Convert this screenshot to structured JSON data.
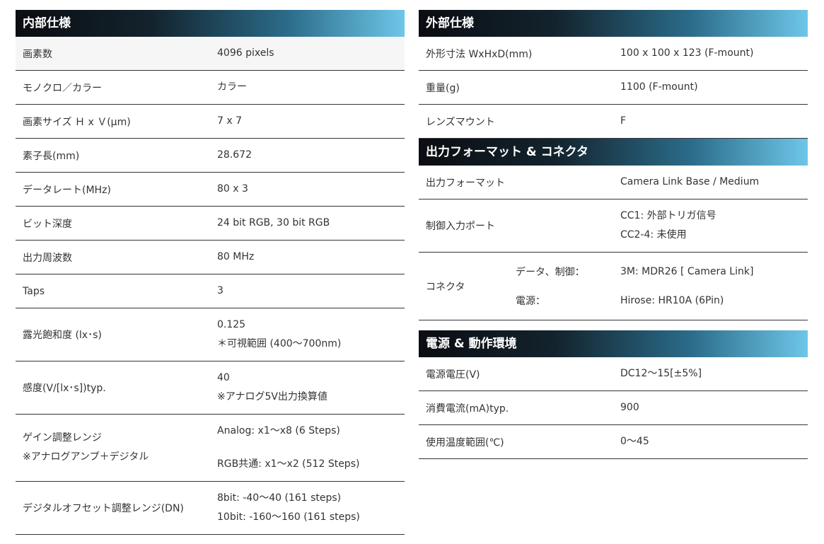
{
  "left": {
    "title": "内部仕様",
    "rows": [
      {
        "label": "画素数",
        "values": [
          "4096 pixels"
        ]
      },
      {
        "label": "モノクロ／カラー",
        "values": [
          "カラー"
        ]
      },
      {
        "label": "画素サイズ Ｈ x Ｖ(μm)",
        "values": [
          "7 x 7"
        ]
      },
      {
        "label": "素子長(mm)",
        "values": [
          "28.672"
        ]
      },
      {
        "label": "データレート(MHz)",
        "values": [
          "80 x 3"
        ]
      },
      {
        "label": "ビット深度",
        "values": [
          "24 bit RGB, 30 bit RGB"
        ]
      },
      {
        "label": "出力周波数",
        "values": [
          "80 MHz"
        ]
      },
      {
        "label": "Taps",
        "values": [
          "3"
        ]
      },
      {
        "label": "露光飽和度 (lx･s)",
        "values": [
          "0.125",
          "＊可視範囲 (400〜700nm)"
        ]
      },
      {
        "label": "感度(V/[lx･s])typ.",
        "values": [
          "40",
          "※アナログ5V出力換算値"
        ]
      },
      {
        "label_lines": [
          "ゲイン調整レンジ",
          "※アナログアンプ＋デジタル"
        ],
        "values": [
          "Analog: x1〜x8 (6 Steps)",
          "RGB共通: x1〜x2 (512 Steps)"
        ]
      },
      {
        "label": "デジタルオフセット調整レンジ(DN)",
        "values": [
          "8bit: -40〜40 (161 steps)",
          "10bit: -160〜160 (161 steps)"
        ]
      }
    ]
  },
  "right_external": {
    "title": "外部仕様",
    "rows": [
      {
        "label": "外形寸法 WxHxD(mm)",
        "values": [
          "100 x 100 x 123 (F-mount)"
        ]
      },
      {
        "label": "重量(g)",
        "values": [
          "1100 (F-mount)"
        ]
      },
      {
        "label": "レンズマウント",
        "values": [
          "F"
        ]
      }
    ]
  },
  "right_output": {
    "title": "出力フォーマット & コネクタ",
    "rows": [
      {
        "label": "出力フォーマット",
        "values": [
          "Camera Link Base / Medium"
        ]
      },
      {
        "label": "制御入力ポート",
        "values": [
          "CC1: 外部トリガ信号",
          "CC2-4: 未使用"
        ]
      }
    ],
    "connector": {
      "label": "コネクタ",
      "items": [
        {
          "sublabel": "データ、制御：",
          "value": "3M: MDR26 [ Camera Link]"
        },
        {
          "sublabel": "電源：",
          "value": "Hirose: HR10A (6Pin)"
        }
      ]
    }
  },
  "right_power": {
    "title": "電源 & 動作環境",
    "rows": [
      {
        "label": "電源電圧(V)",
        "values": [
          "DC12〜15[±5%]"
        ]
      },
      {
        "label": "消費電流(mA)typ.",
        "values": [
          "900"
        ]
      },
      {
        "label": "使用温度範囲(℃)",
        "values": [
          "0〜45"
        ]
      }
    ]
  }
}
